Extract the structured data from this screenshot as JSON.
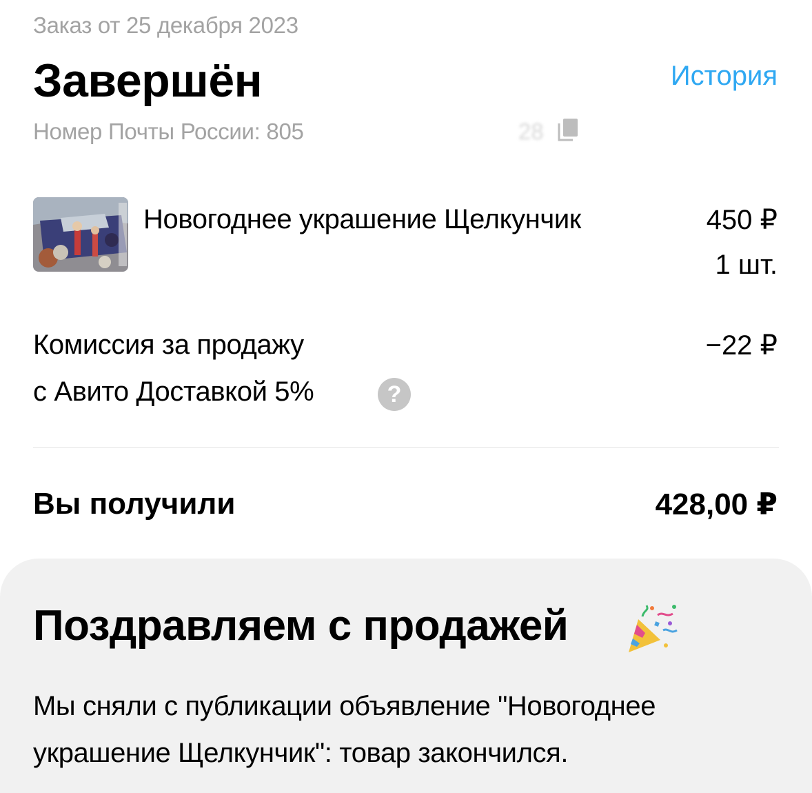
{
  "order": {
    "date": "Заказ от 25 декабря 2023",
    "status": "Завершён",
    "history_link": "История",
    "tracking_label": "Номер Почты России: 805",
    "tracking_tail": "28"
  },
  "item": {
    "name": "Новогоднее украшение Щелкунчик",
    "price": "450 ₽",
    "quantity": "1 шт."
  },
  "commission": {
    "line1": "Комиссия за продажу",
    "line2": "с Авито Доставкой 5%",
    "amount": "−22 ₽",
    "help_glyph": "?"
  },
  "total": {
    "label": "Вы получили",
    "amount": "428,00 ₽"
  },
  "congrats": {
    "title": "Поздравляем с продажей",
    "icon": "party-popper-icon",
    "text": "Мы сняли с публикации объявление \"Новогоднее украшение Щелкунчик\": товар закончился."
  },
  "colors": {
    "link": "#2fa8f2",
    "muted_text": "#a3a3a3",
    "card_background": "#f1f1f1",
    "help_icon": "#c6c6c6"
  }
}
